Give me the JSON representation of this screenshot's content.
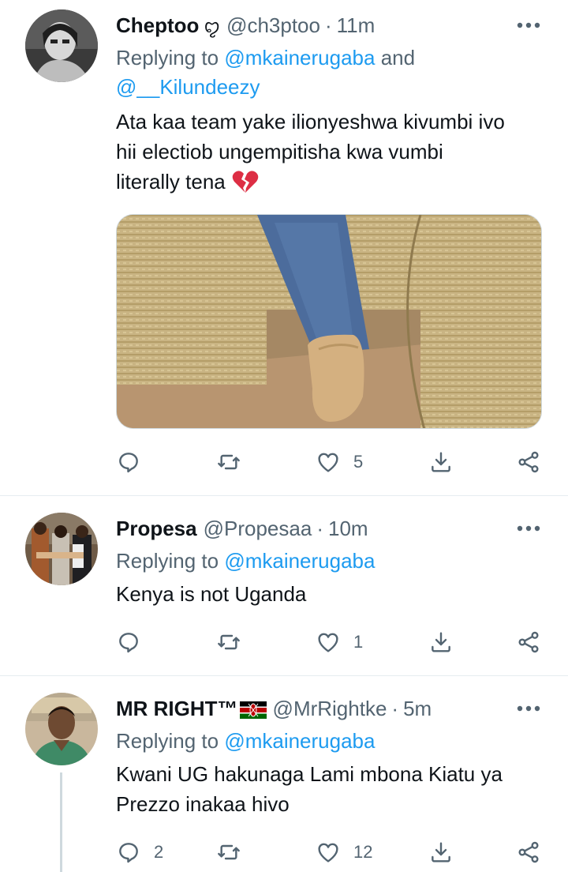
{
  "tweets": [
    {
      "name": "Cheptoo",
      "name_emoji": "ꨄ︎",
      "handle": "@ch3ptoo",
      "sep": "·",
      "time": "11m",
      "replying_prefix": "Replying to ",
      "mentions": [
        "@mkainerugaba",
        "@__Kilundeezy"
      ],
      "mention_join": " and ",
      "text_lines": [
        "Ata kaa team yake ilionyeshwa kivumbi ivo",
        "hii electiob ungempitisha kwa vumbi",
        "literally tena"
      ],
      "text_emoji": "💔",
      "reply_count": "",
      "retweet_count": "",
      "like_count": "5"
    },
    {
      "name": "Propesa",
      "handle": "@Propesaa",
      "sep": "·",
      "time": "10m",
      "replying_prefix": "Replying to ",
      "mentions": [
        "@mkainerugaba"
      ],
      "text_lines": [
        "Kenya is not Uganda"
      ],
      "reply_count": "",
      "retweet_count": "",
      "like_count": "1"
    },
    {
      "name": "MR RIGHT™",
      "handle": "@MrRightke",
      "sep": "·",
      "time": "5m",
      "replying_prefix": "Replying to ",
      "mentions": [
        "@mkainerugaba"
      ],
      "text_lines": [
        "Kwani UG hakunaga Lami mbona Kiatu ya",
        "Prezzo inakaa hivo"
      ],
      "reply_count": "2",
      "retweet_count": "",
      "like_count": "12"
    }
  ],
  "colors": {
    "text": "#0f1419",
    "secondary": "#536471",
    "accent": "#1d9bf0",
    "divider": "#e6ecf0"
  },
  "icons": [
    "more-icon",
    "reply-icon",
    "retweet-icon",
    "like-icon",
    "download-icon",
    "share-icon",
    "broken-heart-emoji",
    "kenya-flag-icon"
  ]
}
